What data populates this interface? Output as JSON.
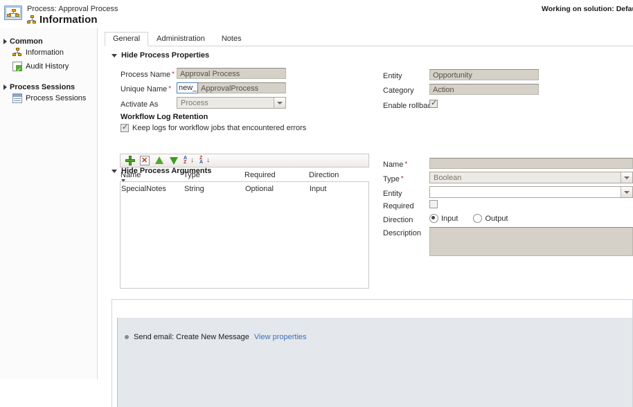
{
  "header": {
    "breadcrumb": "Process: Approval Process",
    "title": "Information",
    "solution_note": "Working on solution: Default So",
    "process_icon": "process-icon"
  },
  "sidebar": {
    "groups": [
      {
        "label": "Common",
        "items": [
          {
            "label": "Information",
            "icon": "process-node-icon"
          },
          {
            "label": "Audit History",
            "icon": "audit-history-icon"
          }
        ]
      },
      {
        "label": "Process Sessions",
        "items": [
          {
            "label": "Process Sessions",
            "icon": "process-sessions-icon"
          }
        ]
      }
    ]
  },
  "tabs": [
    {
      "label": "General",
      "active": true
    },
    {
      "label": "Administration",
      "active": false
    },
    {
      "label": "Notes",
      "active": false
    }
  ],
  "process_properties": {
    "section_label": "Hide Process Properties",
    "process_name_label": "Process Name",
    "process_name_value": "Approval Process",
    "unique_name_label": "Unique Name",
    "unique_name_prefix": "new_",
    "unique_name_value": "ApprovalProcess",
    "activate_as_label": "Activate As",
    "activate_as_value": "Process",
    "entity_label": "Entity",
    "entity_value": "Opportunity",
    "category_label": "Category",
    "category_value": "Action",
    "enable_rollback_label": "Enable rollback",
    "enable_rollback_checked": true,
    "log_retention_heading": "Workflow Log Retention",
    "log_retention_checkbox_label": "Keep logs for workflow jobs that encountered errors",
    "log_retention_checked": true
  },
  "process_arguments": {
    "section_label": "Hide Process Arguments",
    "toolbar": [
      {
        "name": "add-argument-button",
        "icon": "plus-icon"
      },
      {
        "name": "delete-argument-button",
        "icon": "delete-icon"
      },
      {
        "name": "move-up-button",
        "icon": "arrow-up-icon"
      },
      {
        "name": "move-down-button",
        "icon": "arrow-down-icon"
      },
      {
        "name": "sort-ascending-button",
        "icon": "sort-az-icon"
      },
      {
        "name": "sort-descending-button",
        "icon": "sort-za-icon"
      }
    ],
    "columns": [
      "Name",
      "Type",
      "Required",
      "Direction"
    ],
    "rows": [
      {
        "name": "SpecialNotes",
        "type": "String",
        "required": "Optional",
        "direction": "Input"
      }
    ],
    "detail": {
      "name_label": "Name",
      "name_value": "",
      "type_label": "Type",
      "type_value": "Boolean",
      "entity_label": "Entity",
      "entity_value": "",
      "required_label": "Required",
      "required_checked": false,
      "direction_label": "Direction",
      "direction_input_label": "Input",
      "direction_output_label": "Output",
      "direction_selected": "Input",
      "description_label": "Description",
      "description_value": ""
    }
  },
  "designer": {
    "step_label": "Send email: Create New Message",
    "step_link": "View properties"
  }
}
